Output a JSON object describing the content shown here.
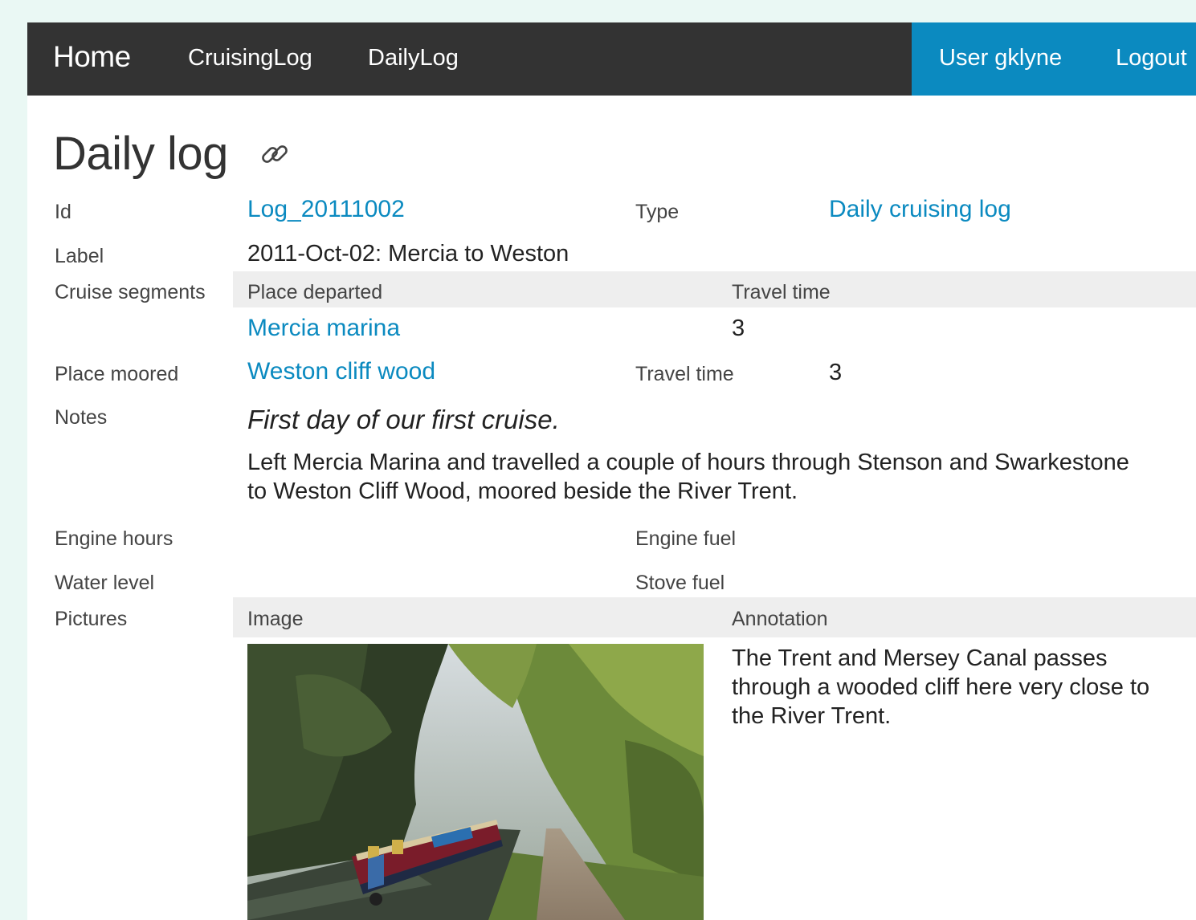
{
  "nav": {
    "home": "Home",
    "cruising_log": "CruisingLog",
    "daily_log": "DailyLog",
    "user": "User gklyne",
    "logout": "Logout"
  },
  "page": {
    "title": "Daily log",
    "link_icon": "link-icon"
  },
  "fields": {
    "id_label": "Id",
    "id_value": "Log_20111002",
    "type_label": "Type",
    "type_value": "Daily cruising log",
    "label_label": "Label",
    "label_value": "2011-Oct-02: Mercia to Weston",
    "segments_label": "Cruise segments",
    "segments_headers": {
      "place_departed": "Place departed",
      "travel_time": "Travel time"
    },
    "segments_rows": [
      {
        "place": "Mercia marina",
        "travel_time": "3"
      }
    ],
    "place_moored_label": "Place moored",
    "place_moored_value": "Weston cliff wood",
    "moored_travel_time_label": "Travel time",
    "moored_travel_time_value": "3",
    "notes_label": "Notes",
    "notes_title": "First day of our first cruise.",
    "notes_body": "Left Mercia Marina and travelled a couple of hours through Stenson and Swarkestone to Weston Cliff Wood, moored beside the River Trent.",
    "engine_hours_label": "Engine hours",
    "engine_fuel_label": "Engine fuel",
    "water_level_label": "Water level",
    "stove_fuel_label": "Stove fuel",
    "pictures_label": "Pictures",
    "pictures_headers": {
      "image": "Image",
      "annotation": "Annotation"
    },
    "pictures_rows": [
      {
        "annotation": "The Trent and Mersey Canal passes through a wooded cliff here very close to the River Trent."
      }
    ]
  },
  "colors": {
    "topbar": "#333333",
    "accent": "#0b8ac0",
    "header_band": "#eeeeee",
    "page_bg": "#eaf8f4"
  }
}
